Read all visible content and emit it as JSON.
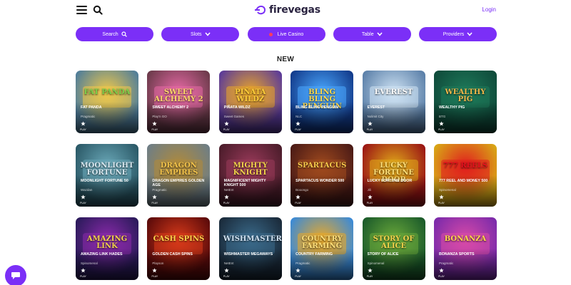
{
  "header": {
    "logo_text": "firevegas",
    "login_label": "Login",
    "menu_icon": "hamburger-menu-icon",
    "search_icon": "search-icon"
  },
  "nav": {
    "search": "Search",
    "slots": "Slots",
    "live_casino": "Live Casino",
    "table": "Table",
    "providers": "Providers"
  },
  "section": {
    "title": "NEW"
  },
  "games": [
    {
      "art": "FAT PANDA",
      "name": "FAT PANDA",
      "provider": "Pragmatic",
      "bg": "#4f7d9a",
      "accent": "#f0c94a",
      "art_color": "#7bd04a"
    },
    {
      "art": "SWEET ALCHEMY 2",
      "name": "SWEET ALCHEMY 2",
      "provider": "Play'n GO",
      "bg": "#6b3a4a",
      "accent": "#e86aa6",
      "art_color": "#ffd86b"
    },
    {
      "art": "PIÑATA WILDZ",
      "name": "PIÑATA WILDZ",
      "provider": "Sweet Games",
      "bg": "#5a3a9a",
      "accent": "#e9a52a",
      "art_color": "#ffce3a"
    },
    {
      "art": "BLING BLING PENGUIN",
      "name": "BLING BLING PENGUIN",
      "provider": "NLC",
      "bg": "#123a8a",
      "accent": "#4aa8ff",
      "art_color": "#ffd94a"
    },
    {
      "art": "EVEREST",
      "name": "EVEREST",
      "provider": "Nolimit City",
      "bg": "#5a7fa8",
      "accent": "#cfe3f4",
      "art_color": "#ffffff"
    },
    {
      "art": "WEALTHY PIG",
      "name": "WEALTHY PIG",
      "provider": "BTG",
      "bg": "#0f4a3a",
      "accent": "#1e7a5a",
      "art_color": "#f2b84a"
    },
    {
      "art": "MOONLIGHT FORTUNE",
      "name": "MOONLIGHT FORTUNE 50",
      "provider": "Wazdan",
      "bg": "#2a5866",
      "accent": "#6aa8b8",
      "art_color": "#d8e8f0"
    },
    {
      "art": "DRAGON EMPIRES",
      "name": "DRAGON EMPIRES GOLDEN AGE",
      "provider": "Pragmatic",
      "bg": "#6e7e86",
      "accent": "#b08a3a",
      "art_color": "#f2c24a"
    },
    {
      "art": "MIGHTY KNIGHT",
      "name": "MAGNIFICENT MIGHTY KNIGHT 500",
      "provider": "NetEnt",
      "bg": "#4a1c2a",
      "accent": "#9a3a5a",
      "art_color": "#f2d24a"
    },
    {
      "art": "SPARTACUS",
      "name": "SPARTACUS WONDER 500",
      "provider": "Booongo",
      "bg": "#4a1a16",
      "accent": "#a04a1e",
      "art_color": "#f7c84a"
    },
    {
      "art": "LUCKY FORTUNE DOOR",
      "name": "LUCKY FORTUNE DOOR",
      "provider": "Jili",
      "bg": "#9a1414",
      "accent": "#e0a91a",
      "art_color": "#ffe07a"
    },
    {
      "art": "777 REELS",
      "name": "777 REEL AND MONEY 500",
      "provider": "Spinomenal",
      "bg": "#d8a816",
      "accent": "#e01e1e",
      "art_color": "#e8101e"
    },
    {
      "art": "AMAZING LINK",
      "name": "AMAZING LINK HADES",
      "provider": "Spinomenal",
      "bg": "#2a1a5a",
      "accent": "#8a2aaa",
      "art_color": "#f2d24a"
    },
    {
      "art": "CASH SPINS",
      "name": "GOLDEN CASH SPINS",
      "provider": "Playson",
      "bg": "#5a0a0a",
      "accent": "#d83a1a",
      "art_color": "#ffd24a"
    },
    {
      "art": "WISHMASTER",
      "name": "WISHMASTER MEGAWAYS",
      "provider": "NetEnt",
      "bg": "#1a2a3a",
      "accent": "#3a6a8a",
      "art_color": "#cfe0f0"
    },
    {
      "art": "COUNTRY FARMING",
      "name": "COUNTRY FARMING",
      "provider": "Pragmatic",
      "bg": "#3a8ad8",
      "accent": "#e8a82a",
      "art_color": "#ffe07a"
    },
    {
      "art": "STORY OF ALICE",
      "name": "STORY OF ALICE",
      "provider": "Spinomenal",
      "bg": "#1a5a2a",
      "accent": "#6aa83a",
      "art_color": "#f2d24a"
    },
    {
      "art": "BONANZA",
      "name": "BONANZA SPORTS",
      "provider": "Pragmatic",
      "bg": "#7a2aaa",
      "accent": "#d84aa8",
      "art_color": "#ffd84a"
    }
  ],
  "tile_labels": {
    "play": "PLAY"
  },
  "chat": {
    "icon": "chat-bubble-icon"
  },
  "colors": {
    "brand": "#7b2ff7",
    "live_dot": "#ff3b5c"
  }
}
